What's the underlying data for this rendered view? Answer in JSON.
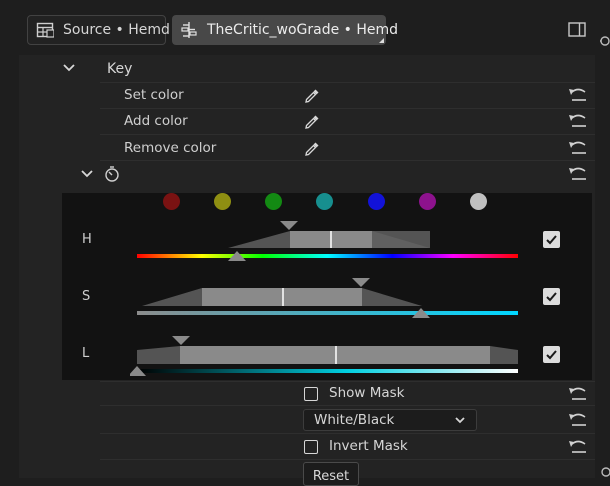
{
  "tabs": [
    {
      "label": "Source • Hemd",
      "icon": "table-icon",
      "active": false
    },
    {
      "label": "TheCritic_woGrade • Hemd",
      "icon": "effect-tree-icon",
      "active": true
    }
  ],
  "key_section": {
    "title": "Key",
    "rows": [
      {
        "label": "Set color",
        "icon": "eyedropper-icon"
      },
      {
        "label": "Add color",
        "icon": "eyedropper-icon"
      },
      {
        "label": "Remove color",
        "icon": "eyedropper-icon"
      }
    ]
  },
  "swatches": [
    "#7a1212",
    "#8f8f12",
    "#138a13",
    "#178f8f",
    "#1212d8",
    "#8d128d",
    "#c0c0c0"
  ],
  "hsl": {
    "hue": {
      "label": "H",
      "enabled": true
    },
    "saturation": {
      "label": "S",
      "enabled": true
    },
    "lightness": {
      "label": "L",
      "enabled": true
    }
  },
  "options": {
    "show_mask": {
      "label": "Show Mask",
      "checked": false
    },
    "mask_mode": {
      "value": "White/Black"
    },
    "invert_mask": {
      "label": "Invert Mask",
      "checked": false
    },
    "reset_button": {
      "label": "Reset"
    }
  },
  "colors": {
    "accent_track": "#00c8ff",
    "panel": "#232323"
  }
}
